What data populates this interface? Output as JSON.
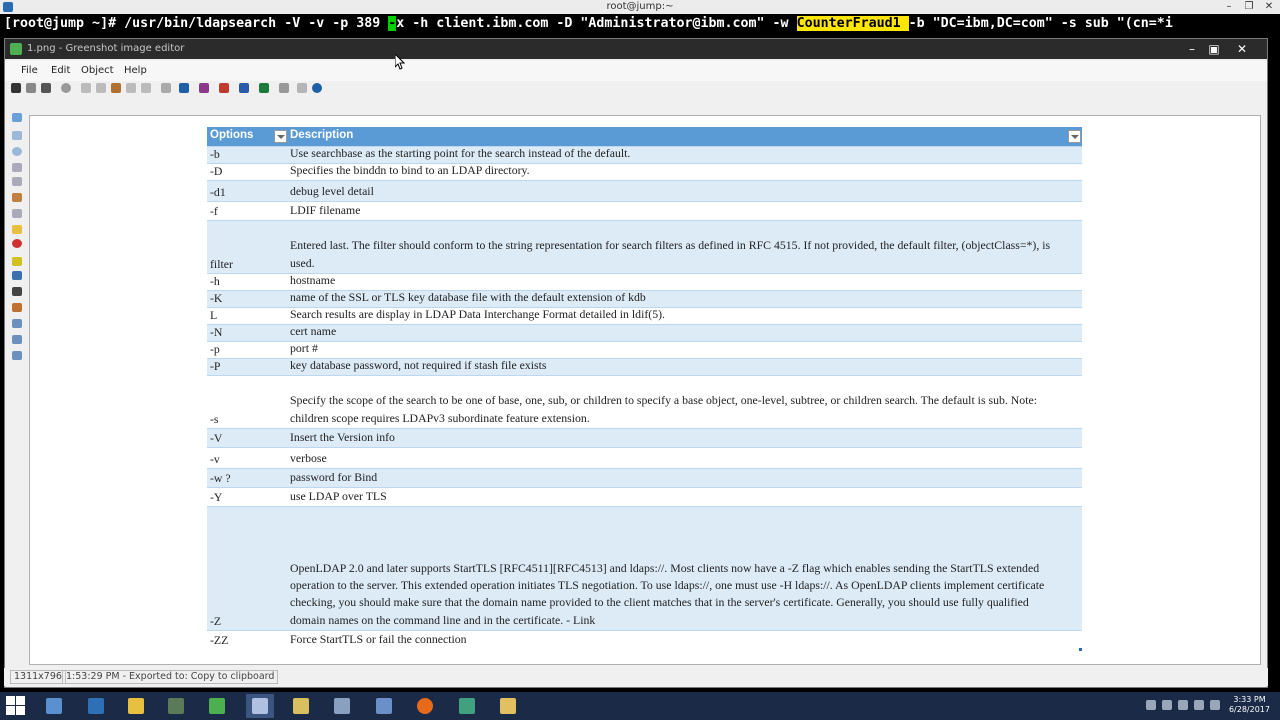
{
  "terminal": {
    "title": "root@jump:~",
    "cmd_prefix": "[root@jump ~]# /usr/bin/ldapsearch -V -v -p 389 ",
    "cmd_green": "-",
    "cmd_mid": "x -h client.ibm.com -D \"Administrator@ibm.com\" -w ",
    "cmd_yellow": "CounterFraud1 ",
    "cmd_suffix": "-b \"DC=ibm,DC=com\" -s sub \"(cn=*i"
  },
  "window": {
    "title": "1.png - Greenshot image editor",
    "menu": [
      "File",
      "Edit",
      "Object",
      "Help"
    ]
  },
  "table": {
    "header_options": "Options",
    "header_description": "Description",
    "rows": [
      {
        "opt": "-b",
        "desc": "Use searchbase as the starting point for the search instead of the default."
      },
      {
        "opt": "-D",
        "desc": "Specifies the binddn to bind to an LDAP directory."
      },
      {
        "opt": " -d1",
        "desc": "debug level detail"
      },
      {
        "opt": "-f",
        "desc": "LDIF filename"
      },
      {
        "opt": "filter",
        "desc": "Entered last. The filter should conform to the string representation for search filters as defined in RFC 4515. If not provided, the default filter, (objectClass=*), is used."
      },
      {
        "opt": "-h",
        "desc": "hostname"
      },
      {
        "opt": "-K",
        "desc": "name of the SSL or TLS key database file with the default extension of kdb"
      },
      {
        "opt": "L",
        "desc": "Search results are display in LDAP Data Interchange Format detailed in ldif(5)."
      },
      {
        "opt": "-N",
        "desc": "cert name"
      },
      {
        "opt": "-p",
        "desc": "port #"
      },
      {
        "opt": "-P",
        "desc": "key database password, not required if stash file exists"
      },
      {
        "opt": "-s",
        "desc": "Specify the scope of the search to be one of base, one, sub, or children to specify a base object, one-level, subtree, or children search. The default is sub. Note: children scope requires LDAPv3 subordinate feature extension."
      },
      {
        "opt": "-V",
        "desc": "Insert the Version info"
      },
      {
        "opt": "-v",
        "desc": "verbose"
      },
      {
        "opt": "-w ?",
        "desc": " password for Bind"
      },
      {
        "opt": "-Y",
        "desc": "use LDAP over TLS"
      },
      {
        "opt": "-Z",
        "desc": "OpenLDAP 2.0 and later supports StartTLS [RFC4511][RFC4513] and ldaps://. Most clients now have a -Z flag which enables sending the StartTLS extended operation to the server. This extended operation initiates TLS negotiation. To use ldaps://, one must use -H ldaps://. As OpenLDAP clients implement certificate checking, you should make sure that the domain name provided to the client matches that in the server's certificate. Generally, you should use fully qualified domain names on the command line and in the certificate. - Link"
      },
      {
        "opt": "-ZZ",
        "desc": "Force StartTLS or fail the connection"
      }
    ]
  },
  "status": {
    "dimensions": "1311x796",
    "message": "1:53:29 PM - Exported to: Copy to clipboard"
  },
  "clock": {
    "time": "3:33 PM",
    "date": "6/28/2017"
  },
  "colors": {
    "header": "#5b9bd5",
    "row_alt": "#ddebf7",
    "highlight_green": "#00d000",
    "highlight_yellow": "#ffe600",
    "taskbar": "#1b2a47"
  }
}
